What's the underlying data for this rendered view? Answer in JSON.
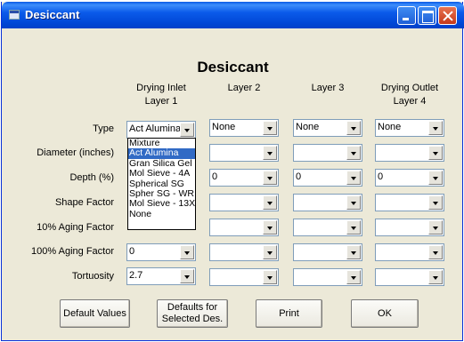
{
  "window": {
    "title": "Desiccant"
  },
  "heading": "Desiccant",
  "columns": [
    {
      "line1": "Drying Inlet",
      "line2": "Layer 1"
    },
    {
      "line1": "",
      "line2": "Layer 2"
    },
    {
      "line1": "",
      "line2": "Layer 3"
    },
    {
      "line1": "Drying Outlet",
      "line2": "Layer 4"
    }
  ],
  "rows": [
    {
      "label": "Type",
      "values": [
        "Act Alumina",
        "None",
        "None",
        "None"
      ]
    },
    {
      "label": "Diameter (inches)",
      "values": [
        "",
        "",
        "",
        ""
      ]
    },
    {
      "label": "Depth (%)",
      "values": [
        "",
        "0",
        "0",
        "0"
      ]
    },
    {
      "label": "Shape Factor",
      "values": [
        "",
        "",
        "",
        ""
      ]
    },
    {
      "label": "10% Aging Factor",
      "values": [
        "",
        "",
        "",
        ""
      ]
    },
    {
      "label": "100% Aging Factor",
      "values": [
        "0",
        "",
        "",
        ""
      ]
    },
    {
      "label": "Tortuosity",
      "values": [
        "2.7",
        "",
        "",
        ""
      ]
    }
  ],
  "type_dropdown": {
    "options": [
      "Mixture",
      "Act Alumina",
      "Gran Silica Gel",
      "Mol Sieve - 4A",
      "Spherical SG",
      "Spher SG - WR",
      "Mol Sieve - 13X",
      "None"
    ],
    "selected": "Act Alumina"
  },
  "buttons": {
    "default_values": "Default Values",
    "defaults_selected_line1": "Defaults for",
    "defaults_selected_line2": "Selected Des.",
    "print": "Print",
    "ok": "OK"
  }
}
